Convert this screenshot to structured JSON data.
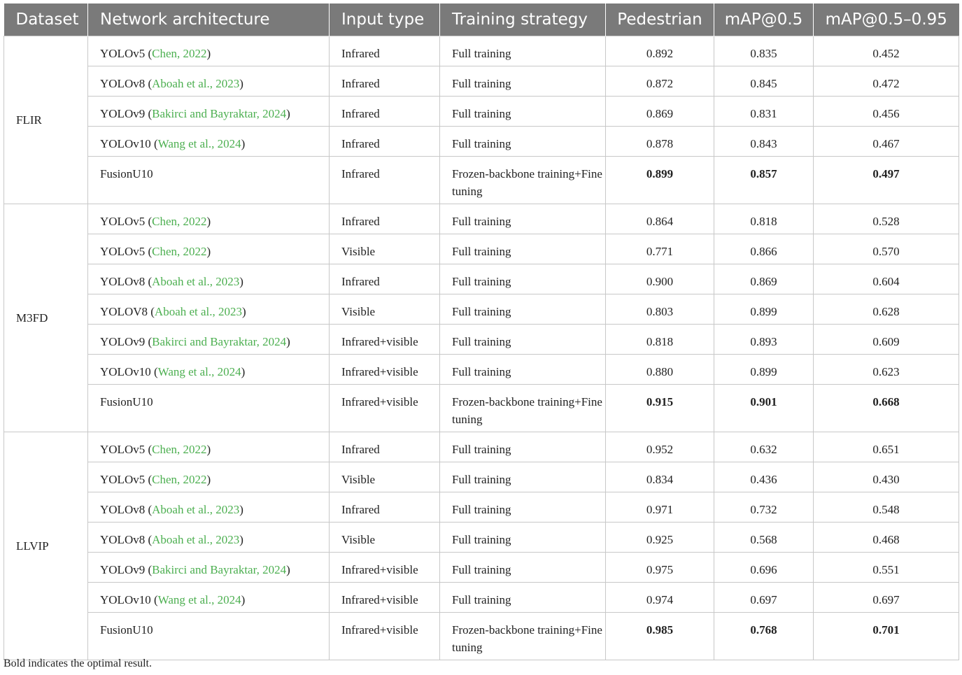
{
  "table": {
    "headers": [
      "Dataset",
      "Network architecture",
      "Input type",
      "Training strategy",
      "Pedestrian",
      "mAP@0.5",
      "mAP@0.5–0.95"
    ],
    "groups": [
      {
        "dataset": "FLIR",
        "rows": [
          {
            "model": "YOLOv5",
            "cite": "Chen, 2022",
            "input": "Infrared",
            "strategy": "Full training",
            "pedestrian": "0.892",
            "map50": "0.835",
            "map5095": "0.452"
          },
          {
            "model": "YOLOv8",
            "cite": "Aboah et al., 2023",
            "input": "Infrared",
            "strategy": "Full training",
            "pedestrian": "0.872",
            "map50": "0.845",
            "map5095": "0.472"
          },
          {
            "model": "YOLOv9",
            "cite": "Bakirci and Bayraktar, 2024",
            "input": "Infrared",
            "strategy": "Full training",
            "pedestrian": "0.869",
            "map50": "0.831",
            "map5095": "0.456"
          },
          {
            "model": "YOLOv10",
            "cite": "Wang et al., 2024",
            "input": "Infrared",
            "strategy": "Full training",
            "pedestrian": "0.878",
            "map50": "0.843",
            "map5095": "0.467"
          },
          {
            "model": "FusionU10",
            "input": "Infrared",
            "strategy": "Frozen-backbone training+Fine tuning",
            "pedestrian": "0.899",
            "map50": "0.857",
            "map5095": "0.497",
            "bold": true
          }
        ]
      },
      {
        "dataset": "M3FD",
        "rows": [
          {
            "model": "YOLOv5",
            "cite": "Chen, 2022",
            "input": "Infrared",
            "strategy": "Full training",
            "pedestrian": "0.864",
            "map50": "0.818",
            "map5095": "0.528"
          },
          {
            "model": "YOLOv5",
            "cite": "Chen, 2022",
            "input": "Visible",
            "strategy": "Full training",
            "pedestrian": "0.771",
            "map50": "0.866",
            "map5095": "0.570"
          },
          {
            "model": "YOLOv8",
            "cite": "Aboah et al., 2023",
            "input": "Infrared",
            "strategy": "Full training",
            "pedestrian": "0.900",
            "map50": "0.869",
            "map5095": "0.604"
          },
          {
            "model": "YOLOV8",
            "cite": "Aboah et al., 2023",
            "input": "Visible",
            "strategy": "Full training",
            "pedestrian": "0.803",
            "map50": "0.899",
            "map5095": "0.628"
          },
          {
            "model": "YOLOv9",
            "cite": "Bakirci and Bayraktar, 2024",
            "input": "Infrared+visible",
            "strategy": "Full training",
            "pedestrian": "0.818",
            "map50": "0.893",
            "map5095": "0.609"
          },
          {
            "model": "YOLOv10",
            "cite": "Wang et al., 2024",
            "input": "Infrared+visible",
            "strategy": "Full training",
            "pedestrian": "0.880",
            "map50": "0.899",
            "map5095": "0.623"
          },
          {
            "model": "FusionU10",
            "input": "Infrared+visible",
            "strategy": "Frozen-backbone training+Fine tuning",
            "pedestrian": "0.915",
            "map50": "0.901",
            "map5095": "0.668",
            "bold": true
          }
        ]
      },
      {
        "dataset": "LLVIP",
        "rows": [
          {
            "model": "YOLOv5",
            "cite": "Chen, 2022",
            "input": "Infrared",
            "strategy": "Full training",
            "pedestrian": "0.952",
            "map50": "0.632",
            "map5095": "0.651"
          },
          {
            "model": "YOLOv5",
            "cite": "Chen, 2022",
            "input": "Visible",
            "strategy": "Full training",
            "pedestrian": "0.834",
            "map50": "0.436",
            "map5095": "0.430"
          },
          {
            "model": "YOLOv8",
            "cite": "Aboah et al., 2023",
            "input": "Infrared",
            "strategy": "Full training",
            "pedestrian": "0.971",
            "map50": "0.732",
            "map5095": "0.548"
          },
          {
            "model": "YOLOv8",
            "cite": "Aboah et al., 2023",
            "input": "Visible",
            "strategy": "Full training",
            "pedestrian": "0.925",
            "map50": "0.568",
            "map5095": "0.468"
          },
          {
            "model": "YOLOv9",
            "cite": "Bakirci and Bayraktar, 2024",
            "input": "Infrared+visible",
            "strategy": "Full training",
            "pedestrian": "0.975",
            "map50": "0.696",
            "map5095": "0.551"
          },
          {
            "model": "YOLOv10",
            "cite": "Wang et al., 2024",
            "input": "Infrared+visible",
            "strategy": "Full training",
            "pedestrian": "0.974",
            "map50": "0.697",
            "map5095": "0.697"
          },
          {
            "model": "FusionU10",
            "input": "Infrared+visible",
            "strategy": "Frozen-backbone training+Fine tuning",
            "pedestrian": "0.985",
            "map50": "0.768",
            "map5095": "0.701",
            "bold": true
          }
        ]
      }
    ]
  },
  "footnote": "Bold indicates the optimal result.",
  "colors": {
    "header_bg": "#7a7a7a",
    "citation": "#4caf50",
    "border": "#c8c8c8"
  }
}
